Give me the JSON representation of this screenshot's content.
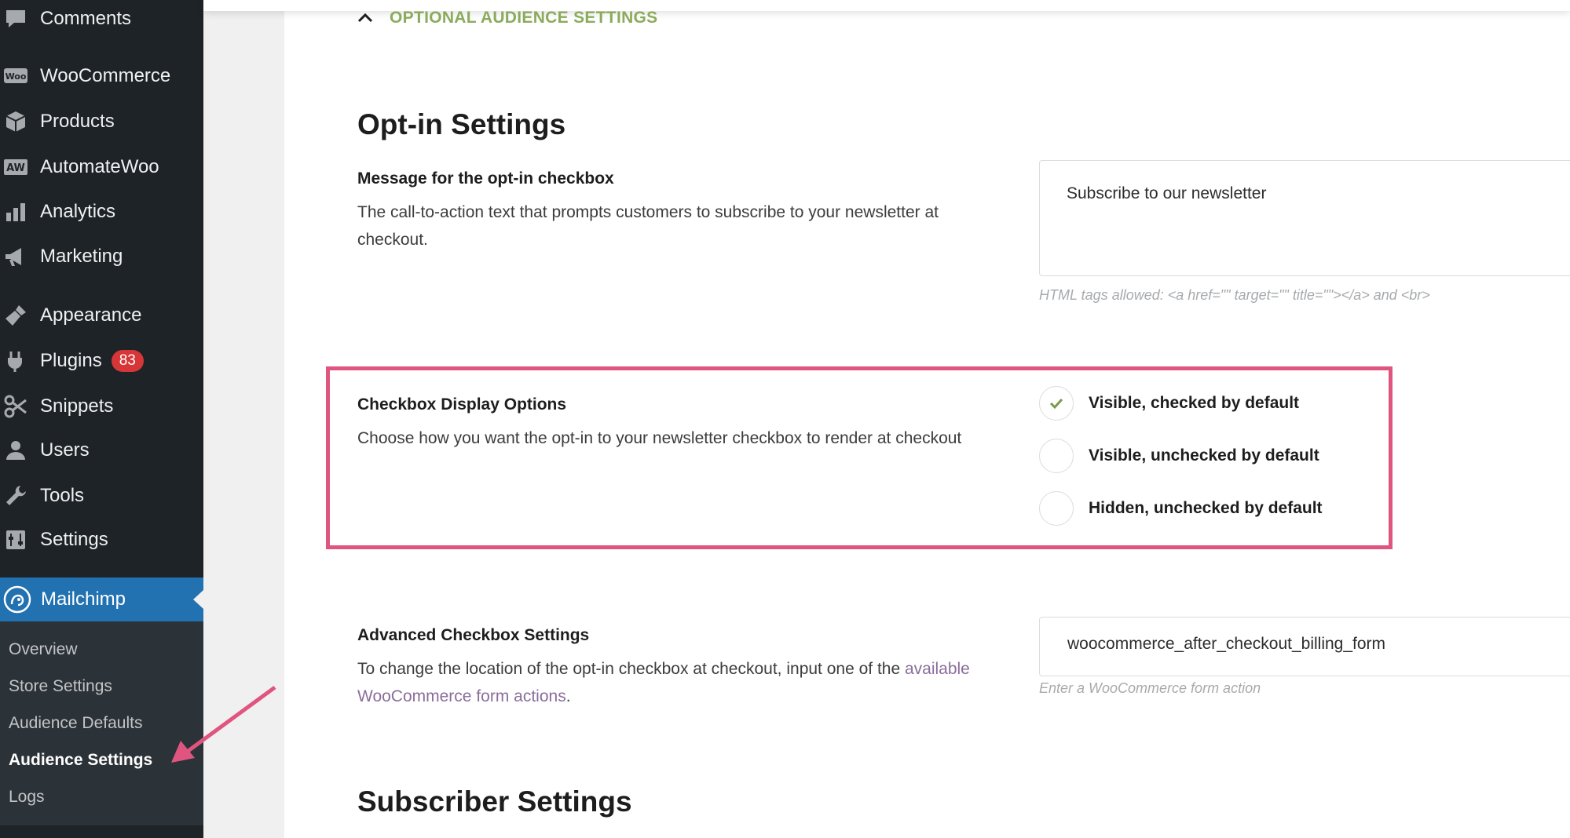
{
  "sidebar": {
    "items": [
      {
        "label": "Comments",
        "icon": "comments-icon"
      },
      {
        "label": "WooCommerce",
        "icon": "woocommerce-icon"
      },
      {
        "label": "Products",
        "icon": "products-icon"
      },
      {
        "label": "AutomateWoo",
        "icon": "automatewoo-icon"
      },
      {
        "label": "Analytics",
        "icon": "analytics-icon"
      },
      {
        "label": "Marketing",
        "icon": "marketing-icon"
      },
      {
        "label": "Appearance",
        "icon": "appearance-icon"
      },
      {
        "label": "Plugins",
        "icon": "plugins-icon",
        "badge": "83"
      },
      {
        "label": "Snippets",
        "icon": "snippets-icon"
      },
      {
        "label": "Users",
        "icon": "users-icon"
      },
      {
        "label": "Tools",
        "icon": "tools-icon"
      },
      {
        "label": "Settings",
        "icon": "settings-icon"
      }
    ],
    "icon_labels": {
      "woo": "Woo",
      "aw": "AW"
    },
    "active": {
      "label": "Mailchimp",
      "icon": "mailchimp-icon"
    },
    "submenu": [
      {
        "label": "Overview"
      },
      {
        "label": "Store Settings"
      },
      {
        "label": "Audience Defaults"
      },
      {
        "label": "Audience Settings",
        "active": true
      },
      {
        "label": "Logs"
      }
    ]
  },
  "main": {
    "section_toggle": "OPTIONAL AUDIENCE SETTINGS",
    "optin": {
      "heading": "Opt-in Settings",
      "message_label": "Message for the opt-in checkbox",
      "message_desc": "The call-to-action text that prompts customers to subscribe to your newsletter at checkout.",
      "message_value": "Subscribe to our newsletter",
      "message_hint": "HTML tags allowed: <a href=\"\" target=\"\" title=\"\"></a> and <br>",
      "display_label": "Checkbox Display Options",
      "display_desc": "Choose how you want the opt-in to your newsletter checkbox to render at checkout",
      "display_options": [
        {
          "label": "Visible, checked by default",
          "selected": true
        },
        {
          "label": "Visible, unchecked by default",
          "selected": false
        },
        {
          "label": "Hidden, unchecked by default",
          "selected": false
        }
      ],
      "advanced_label": "Advanced Checkbox Settings",
      "advanced_desc_prefix": "To change the location of the opt-in checkbox at checkout, input one of the ",
      "advanced_desc_link": "available WooCommerce form actions",
      "advanced_desc_suffix": ".",
      "advanced_value": "woocommerce_after_checkout_billing_form",
      "advanced_hint": "Enter a WooCommerce form action"
    },
    "subscriber_heading": "Subscriber Settings"
  },
  "colors": {
    "sidebar_bg": "#1d2327",
    "active_blue": "#2271b1",
    "badge_red": "#d63638",
    "section_green": "#8bab5c",
    "highlight_pink": "#e0557f",
    "link_purple": "#8a6d9b"
  }
}
